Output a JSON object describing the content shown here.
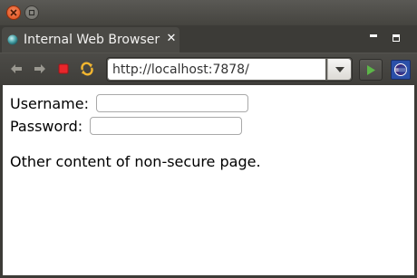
{
  "window": {
    "close_icon": "close-icon",
    "minimize_icon": "minimize-icon"
  },
  "tab": {
    "title": "Internal Web Browser",
    "close_label": "✕",
    "icon": "globe-icon"
  },
  "view_controls": {
    "minimize_icon": "view-minimize-icon",
    "maximize_icon": "view-maximize-icon"
  },
  "toolbar": {
    "back_icon": "back-arrow-icon",
    "forward_icon": "forward-arrow-icon",
    "stop_icon": "stop-icon",
    "refresh_icon": "refresh-icon",
    "url": "http://localhost:7878/",
    "dropdown_icon": "chevron-down-icon",
    "go_icon": "go-arrow-icon",
    "eclipse_icon": "eclipse-icon"
  },
  "page": {
    "username_label": "Username:",
    "password_label": "Password:",
    "username_value": "",
    "password_value": "",
    "body_text": "Other content of non-secure page."
  },
  "colors": {
    "close_button": "#df4a16",
    "stop_icon": "#e8262b",
    "go_icon": "#5cb648",
    "eclipse_blue": "#2a4fa8"
  }
}
